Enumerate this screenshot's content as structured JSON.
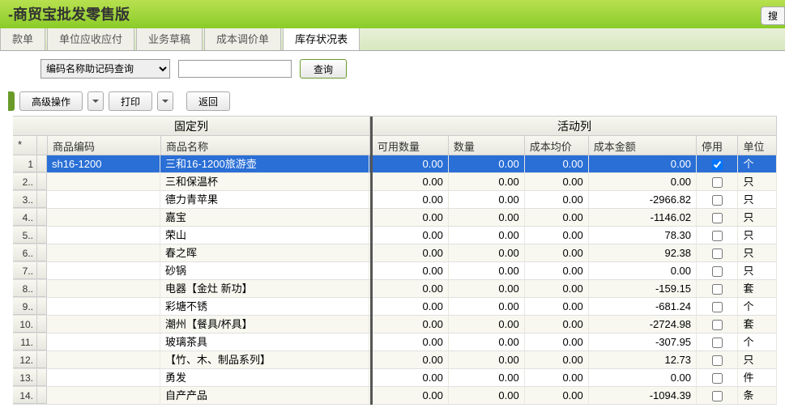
{
  "header": {
    "title": "-商贸宝批发零售版",
    "search_label": "搜"
  },
  "tabs": [
    "款单",
    "单位应收应付",
    "业务草稿",
    "成本调价单",
    "库存状况表"
  ],
  "active_tab": 4,
  "search": {
    "mode_options": [
      "编码名称助记码查询"
    ],
    "mode_selected": "编码名称助记码查询",
    "query_value": "",
    "button": "查询"
  },
  "toolbar": {
    "advanced": "高级操作",
    "print": "打印",
    "back": "返回"
  },
  "grid": {
    "fixed_group": "固定列",
    "scroll_group": "活动列",
    "headers": {
      "rownum": "*",
      "code": "商品编码",
      "name": "商品名称",
      "avail": "可用数量",
      "qty": "数量",
      "costprice": "成本均价",
      "costamt": "成本金额",
      "disable": "停用",
      "unit": "单位"
    },
    "rows": [
      {
        "n": "1",
        "code": "sh16-1200",
        "name": "三和16-1200旅游壶",
        "avail": "0.00",
        "qty": "0.00",
        "costprice": "0.00",
        "costamt": "0.00",
        "disable": true,
        "unit": "个",
        "selected": true
      },
      {
        "n": "2..",
        "code": "",
        "name": "三和保温杯",
        "avail": "0.00",
        "qty": "0.00",
        "costprice": "0.00",
        "costamt": "0.00",
        "disable": false,
        "unit": "只"
      },
      {
        "n": "3..",
        "code": "",
        "name": "德力青苹果",
        "avail": "0.00",
        "qty": "0.00",
        "costprice": "0.00",
        "costamt": "-2966.82",
        "disable": false,
        "unit": "只"
      },
      {
        "n": "4..",
        "code": "",
        "name": "嘉宝",
        "avail": "0.00",
        "qty": "0.00",
        "costprice": "0.00",
        "costamt": "-1146.02",
        "disable": false,
        "unit": "只"
      },
      {
        "n": "5..",
        "code": "",
        "name": "荣山",
        "avail": "0.00",
        "qty": "0.00",
        "costprice": "0.00",
        "costamt": "78.30",
        "disable": false,
        "unit": "只"
      },
      {
        "n": "6..",
        "code": "",
        "name": "春之晖",
        "avail": "0.00",
        "qty": "0.00",
        "costprice": "0.00",
        "costamt": "92.38",
        "disable": false,
        "unit": "只"
      },
      {
        "n": "7..",
        "code": "",
        "name": "砂锅",
        "avail": "0.00",
        "qty": "0.00",
        "costprice": "0.00",
        "costamt": "0.00",
        "disable": false,
        "unit": "只"
      },
      {
        "n": "8..",
        "code": "",
        "name": "电器【金灶 新功】",
        "avail": "0.00",
        "qty": "0.00",
        "costprice": "0.00",
        "costamt": "-159.15",
        "disable": false,
        "unit": "套"
      },
      {
        "n": "9..",
        "code": "",
        "name": "彩塘不锈",
        "avail": "0.00",
        "qty": "0.00",
        "costprice": "0.00",
        "costamt": "-681.24",
        "disable": false,
        "unit": "个"
      },
      {
        "n": "10.",
        "code": "",
        "name": "潮州【餐具/杯具】",
        "avail": "0.00",
        "qty": "0.00",
        "costprice": "0.00",
        "costamt": "-2724.98",
        "disable": false,
        "unit": "套"
      },
      {
        "n": "11.",
        "code": "",
        "name": "玻璃茶具",
        "avail": "0.00",
        "qty": "0.00",
        "costprice": "0.00",
        "costamt": "-307.95",
        "disable": false,
        "unit": "个"
      },
      {
        "n": "12.",
        "code": "",
        "name": "【竹、木、制品系列】",
        "avail": "0.00",
        "qty": "0.00",
        "costprice": "0.00",
        "costamt": "12.73",
        "disable": false,
        "unit": "只"
      },
      {
        "n": "13.",
        "code": "",
        "name": "勇发",
        "avail": "0.00",
        "qty": "0.00",
        "costprice": "0.00",
        "costamt": "0.00",
        "disable": false,
        "unit": "件"
      },
      {
        "n": "14.",
        "code": "",
        "name": "自产产品",
        "avail": "0.00",
        "qty": "0.00",
        "costprice": "0.00",
        "costamt": "-1094.39",
        "disable": false,
        "unit": "条"
      }
    ]
  }
}
